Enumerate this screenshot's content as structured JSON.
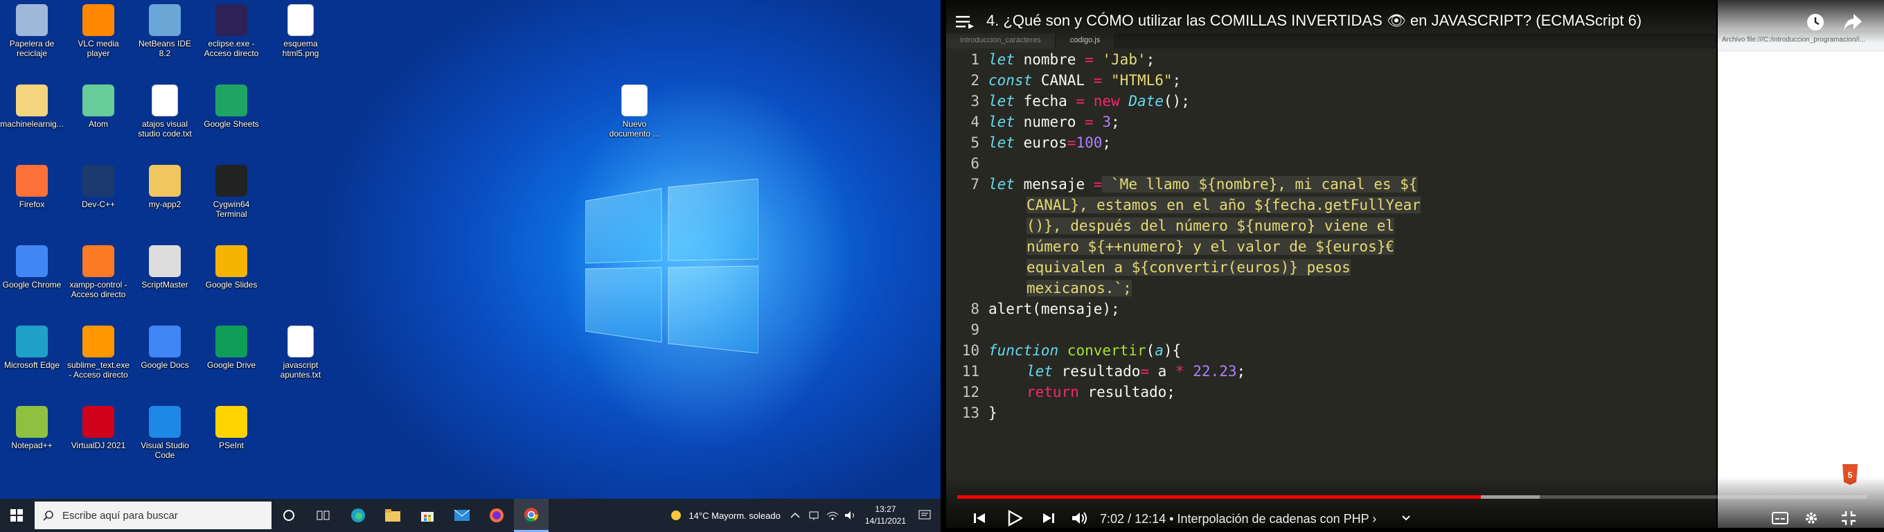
{
  "desktop": {
    "icons": [
      {
        "label": "Papelera de reciclaje",
        "icon": "recycle-bin-icon",
        "color": "#9fb7d8"
      },
      {
        "label": "VLC media player",
        "icon": "vlc-icon",
        "color": "#ff8800"
      },
      {
        "label": "NetBeans IDE 8.2",
        "icon": "netbeans-icon",
        "color": "#6aa6d6"
      },
      {
        "label": "eclipse.exe - Acceso directo",
        "icon": "eclipse-icon",
        "color": "#2c2255"
      },
      {
        "label": "esquema html5.png",
        "icon": "image-file-icon",
        "color": "#ffffff"
      },
      {
        "label": "machinelearnig...",
        "icon": "document-icon",
        "color": "#f4d47c"
      },
      {
        "label": "Atom",
        "icon": "atom-icon",
        "color": "#66cc99"
      },
      {
        "label": "atajos visual studio code.txt",
        "icon": "text-file-icon",
        "color": "#ffffff"
      },
      {
        "label": "Google Sheets",
        "icon": "google-sheets-icon",
        "color": "#1fa463"
      },
      {
        "label": "Firefox",
        "icon": "firefox-icon",
        "color": "#ff7139"
      },
      {
        "label": "Dev-C++",
        "icon": "devcpp-icon",
        "color": "#1c3a6e"
      },
      {
        "label": "my-app2",
        "icon": "folder-icon",
        "color": "#f0c75e"
      },
      {
        "label": "Cygwin64 Terminal",
        "icon": "terminal-icon",
        "color": "#222222"
      },
      {
        "label": "Google Chrome",
        "icon": "chrome-icon",
        "color": "#4285f4"
      },
      {
        "label": "xampp-control - Acceso directo",
        "icon": "xampp-icon",
        "color": "#fb7a24"
      },
      {
        "label": "ScriptMaster",
        "icon": "scriptmaster-icon",
        "color": "#dddddd"
      },
      {
        "label": "Google Slides",
        "icon": "google-slides-icon",
        "color": "#f4b400"
      },
      {
        "label": "Microsoft Edge",
        "icon": "edge-icon",
        "color": "#1fa0c9"
      },
      {
        "label": "sublime_text.exe - Acceso directo",
        "icon": "sublime-icon",
        "color": "#ff9800"
      },
      {
        "label": "Google Docs",
        "icon": "google-docs-icon",
        "color": "#4285f4"
      },
      {
        "label": "Google Drive",
        "icon": "google-drive-icon",
        "color": "#0f9d58"
      },
      {
        "label": "javascript apuntes.txt",
        "icon": "text-file-icon",
        "color": "#ffffff"
      },
      {
        "label": "Notepad++",
        "icon": "notepadpp-icon",
        "color": "#90c040"
      },
      {
        "label": "VirtualDJ 2021",
        "icon": "virtualdj-icon",
        "color": "#d0021b"
      },
      {
        "label": "Visual Studio Code",
        "icon": "vscode-icon",
        "color": "#1e88e5"
      },
      {
        "label": "PSeInt",
        "icon": "pseint-icon",
        "color": "#ffd400"
      },
      {
        "label": "Nuevo documento ...",
        "icon": "text-file-icon",
        "color": "#ffffff"
      }
    ]
  },
  "taskbar": {
    "search_placeholder": "Escribe aquí para buscar",
    "weather": "14°C  Mayorm. soleado",
    "time": "13:27",
    "date": "14/11/2021",
    "apps": [
      "task-view-icon",
      "edge-icon",
      "file-explorer-icon",
      "store-icon",
      "mail-icon",
      "firefox-icon",
      "chrome-icon"
    ]
  },
  "video": {
    "title": "4. ¿Qué son y CÓMO utilizar las COMILLAS INVERTIDAS 👁 en JAVASCRIPT? (ECMAScript 6)",
    "time_current": "7:02",
    "time_total": "12:14",
    "chapter": "• Interpolación de cadenas con PHP ›",
    "progress_played": 0.575,
    "progress_buffered": 0.64,
    "colors": {
      "played": "#ff0000"
    }
  },
  "editor": {
    "tabs": [
      "introduccion_caracteres",
      "codigo.js"
    ],
    "browser_url": "Archivo   file:///C:/introduccion_programacion/i..."
  },
  "code": {
    "line_numbers": [
      "1",
      "2",
      "3",
      "4",
      "5",
      "6",
      "7",
      "",
      "",
      "",
      "",
      "",
      "8",
      "",
      "10",
      "11",
      "12",
      "13"
    ],
    "l1": [
      "let",
      " nombre ",
      "=",
      " 'Jab'",
      ";"
    ],
    "l2": [
      "const",
      " CANAL ",
      "=",
      " \"HTML6\"",
      ";"
    ],
    "l3": [
      "let",
      " fecha ",
      "=",
      " new",
      " Date",
      "();"
    ],
    "l4": [
      "let",
      " numero ",
      "=",
      " 3",
      ";"
    ],
    "l5": [
      "let",
      " euros",
      "=",
      "100",
      ";"
    ],
    "l7a": [
      "let",
      " mensaje ",
      "=",
      " `Me llamo ${nombre}, mi canal es ${"
    ],
    "l7b": "CANAL}, estamos en el año ${fecha.getFullYear",
    "l7c": "()}, después del número ${numero} viene el",
    "l7d": "número ${++numero} y el valor de ${euros}€",
    "l7e": "equivalen a ${convertir(euros)} pesos",
    "l7f": "mexicanos.`;",
    "l8": "alert(mensaje);",
    "l10": [
      "function",
      " convertir",
      "(",
      "a",
      "){"
    ],
    "l11": [
      "let",
      " resultado",
      "=",
      " a ",
      "*",
      " 22.23",
      ";"
    ],
    "l12": [
      "return",
      " resultado;"
    ],
    "l13": "}"
  }
}
